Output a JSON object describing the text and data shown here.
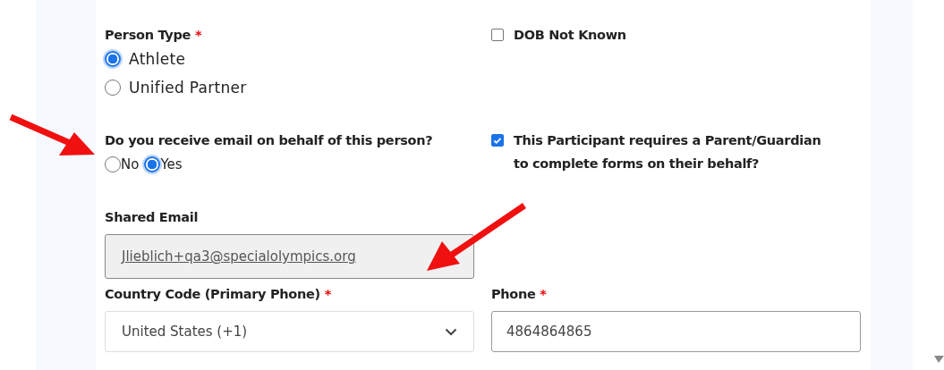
{
  "person_type": {
    "label": "Person Type",
    "required_mark": "*",
    "options": [
      {
        "label": "Athlete",
        "selected": true
      },
      {
        "label": "Unified Partner",
        "selected": false
      }
    ]
  },
  "dob_not_known": {
    "label": "DOB Not Known",
    "checked": false
  },
  "email_on_behalf": {
    "label": "Do you receive email on behalf of this person?",
    "options": [
      {
        "label": "No",
        "selected": false
      },
      {
        "label": "Yes",
        "selected": true
      }
    ]
  },
  "parent_guardian": {
    "label": "This Participant requires a Parent/Guardian to complete forms on their behalf?",
    "checked": true
  },
  "shared_email": {
    "label": "Shared Email",
    "value": "Jlieblich+qa3@specialolympics.org",
    "disabled": true
  },
  "country_code": {
    "label": "Country Code (Primary Phone)",
    "required_mark": "*",
    "value": "United States (+1)"
  },
  "phone": {
    "label": "Phone",
    "required_mark": "*",
    "value": "4864864865"
  }
}
